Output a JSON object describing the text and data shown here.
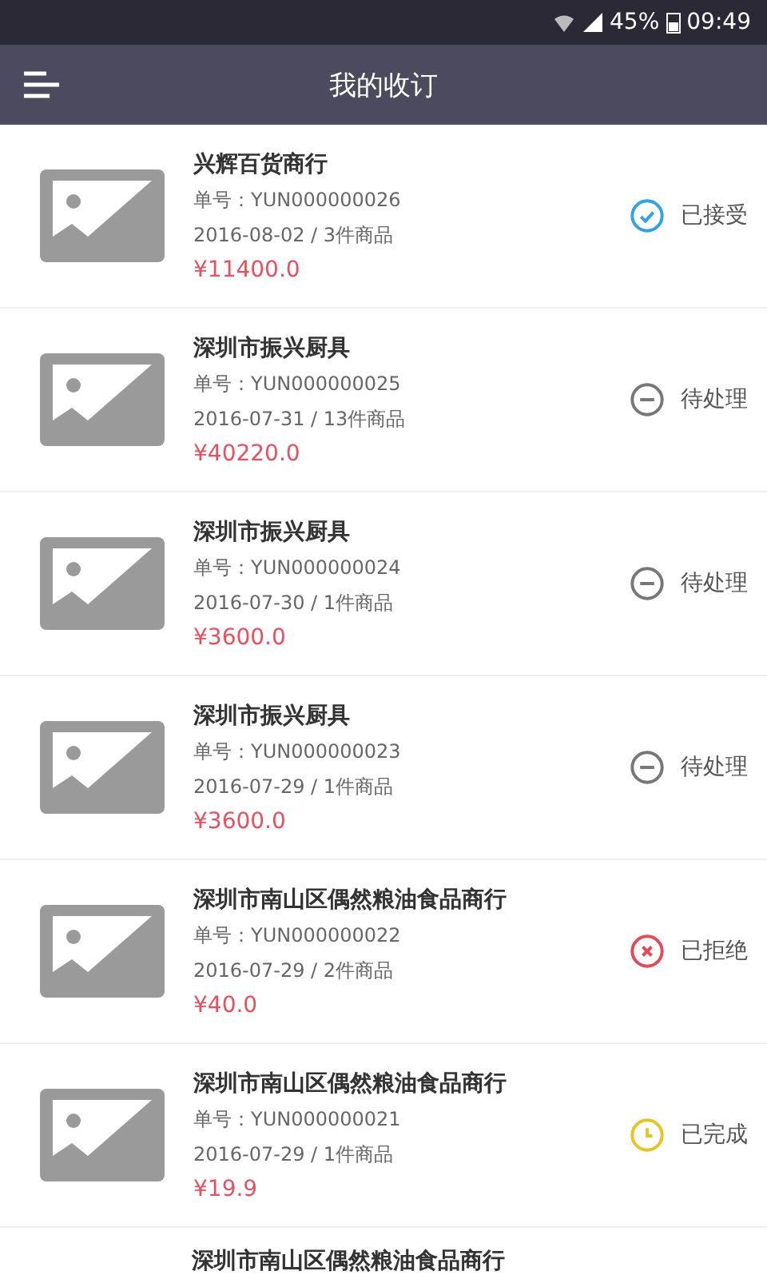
{
  "status_bar": {
    "battery": "45%",
    "time": "09:49"
  },
  "header": {
    "title": "我的收订"
  },
  "orders": [
    {
      "shop": "兴辉百货商行",
      "order_no": "单号：YUN000000026",
      "date_items": "2016-08-02 / 3件商品",
      "price": "¥11400.0",
      "status": {
        "kind": "accepted",
        "label": "已接受"
      }
    },
    {
      "shop": "深圳市振兴厨具",
      "order_no": "单号：YUN000000025",
      "date_items": "2016-07-31 / 13件商品",
      "price": "¥40220.0",
      "status": {
        "kind": "pending",
        "label": "待处理"
      }
    },
    {
      "shop": "深圳市振兴厨具",
      "order_no": "单号：YUN000000024",
      "date_items": "2016-07-30 / 1件商品",
      "price": "¥3600.0",
      "status": {
        "kind": "pending",
        "label": "待处理"
      }
    },
    {
      "shop": "深圳市振兴厨具",
      "order_no": "单号：YUN000000023",
      "date_items": "2016-07-29 / 1件商品",
      "price": "¥3600.0",
      "status": {
        "kind": "pending",
        "label": "待处理"
      }
    },
    {
      "shop": "深圳市南山区偶然粮油食品商行",
      "order_no": "单号：YUN000000022",
      "date_items": "2016-07-29 / 2件商品",
      "price": "¥40.0",
      "status": {
        "kind": "rejected",
        "label": "已拒绝"
      }
    },
    {
      "shop": "深圳市南山区偶然粮油食品商行",
      "order_no": "单号：YUN000000021",
      "date_items": "2016-07-29 / 1件商品",
      "price": "¥19.9",
      "status": {
        "kind": "completed",
        "label": "已完成"
      }
    },
    {
      "shop": "深圳市南山区偶然粮油食品商行"
    }
  ]
}
